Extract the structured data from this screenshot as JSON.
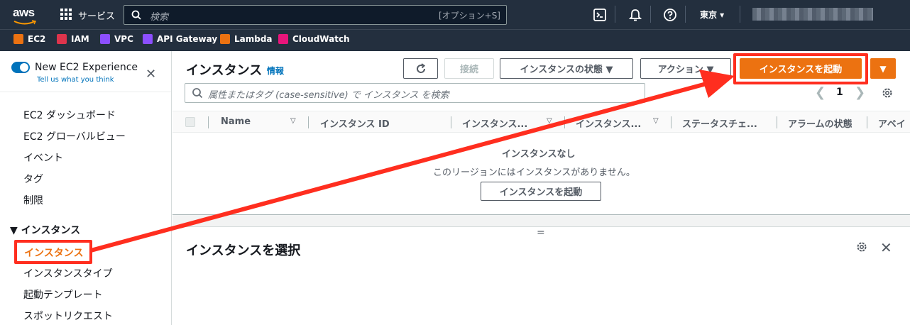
{
  "topbar": {
    "logo_text": "aws",
    "services_label": "サービス",
    "search_placeholder": "検索",
    "search_shortcut": "[オプション+S]",
    "region_label": "東京 ▾"
  },
  "favorites": [
    {
      "label": "EC2",
      "color": "#ec7211"
    },
    {
      "label": "IAM",
      "color": "#dd344c"
    },
    {
      "label": "VPC",
      "color": "#8c4fff"
    },
    {
      "label": "API Gateway",
      "color": "#8c4fff"
    },
    {
      "label": "Lambda",
      "color": "#ec7211"
    },
    {
      "label": "CloudWatch",
      "color": "#e7157b"
    }
  ],
  "sidebar": {
    "experience_title": "New EC2 Experience",
    "experience_link": "Tell us what you think",
    "items": [
      "EC2 ダッシュボード",
      "EC2 グローバルビュー",
      "イベント",
      "タグ",
      "制限"
    ],
    "section_title": "▼ インスタンス",
    "active_item": "インスタンス",
    "sub_items": [
      "インスタンスタイプ",
      "起動テンプレート",
      "スポットリクエスト"
    ]
  },
  "main": {
    "title": "インスタンス",
    "info_link": "情報",
    "connect_label": "接続",
    "state_label": "インスタンスの状態  ▼",
    "actions_label": "アクション  ▼",
    "launch_label": "インスタンスを起動",
    "launch_dropdown": "▼",
    "filter_placeholder": "属性またはタグ (case-sensitive) で インスタンス を検索",
    "page_number": "1",
    "columns": [
      "Name",
      "インスタンス ID",
      "インスタンス...",
      "インスタンス...",
      "ステータスチェ...",
      "アラームの状態",
      "アベイ"
    ],
    "empty_title": "インスタンスなし",
    "empty_subtitle": "このリージョンにはインスタンスがありません。",
    "empty_button": "インスタンスを起動",
    "split_handle": "=",
    "detail_title": "インスタンスを選択"
  },
  "colors": {
    "accent": "#ec7211",
    "highlight": "#ff2e1f",
    "link": "#0073bb",
    "nav_dark": "#232f3e"
  }
}
